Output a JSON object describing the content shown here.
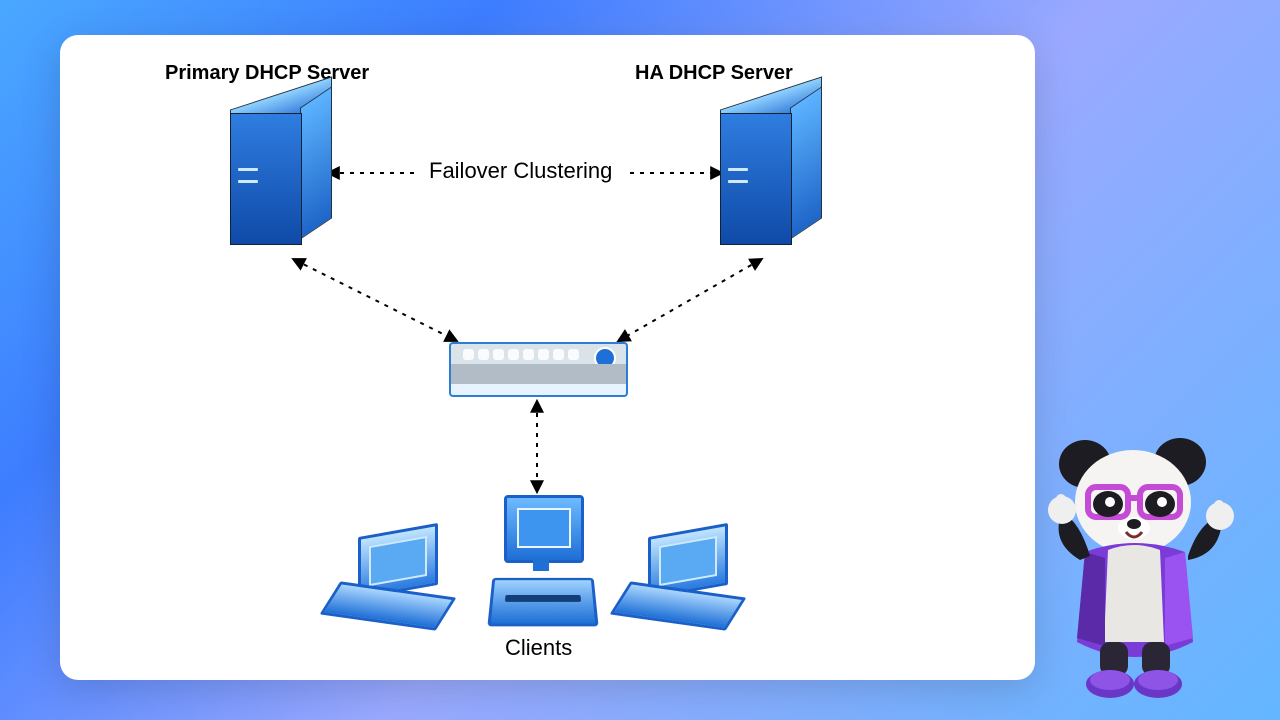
{
  "nodes": {
    "primary": {
      "label": "Primary DHCP Server"
    },
    "ha": {
      "label": "HA DHCP Server"
    },
    "clients": {
      "label": "Clients"
    }
  },
  "links": {
    "failover": {
      "label": "Failover Clustering"
    }
  },
  "icons": {
    "primary": "server-icon",
    "ha": "server-icon",
    "hub": "network-hub-icon",
    "laptop_left": "laptop-icon",
    "desktop_center": "desktop-icon",
    "laptop_right": "laptop-icon",
    "mascot": "panda-mascot"
  },
  "colors": {
    "accent": "#2d7dd2",
    "bg_start": "#4aa8ff",
    "bg_end": "#63b6ff"
  }
}
